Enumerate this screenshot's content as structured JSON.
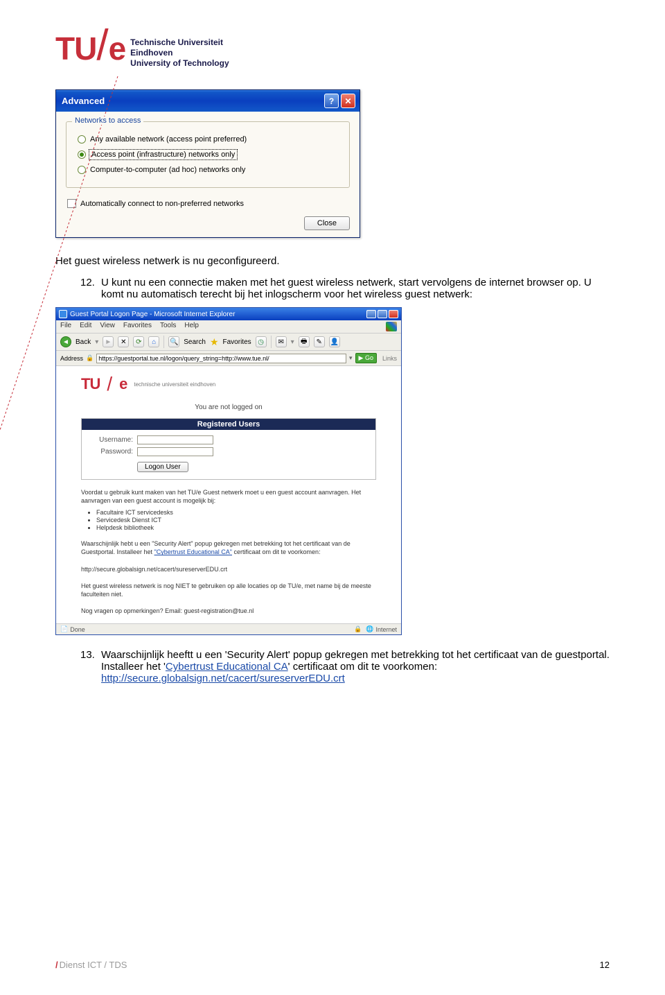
{
  "logo": {
    "tu": "TU",
    "e": "e",
    "line1": "Technische Universiteit",
    "line2_strong": "Eindhoven",
    "line3": "University of Technology"
  },
  "dialog": {
    "title": "Advanced",
    "group_title": "Networks to access",
    "radio1": "Any available network (access point preferred)",
    "radio2": "Access point (infrastructure) networks only",
    "radio3": "Computer-to-computer (ad hoc) networks only",
    "checkbox": "Automatically connect to non-preferred networks",
    "close": "Close"
  },
  "para_intro": "Het guest wireless netwerk is nu geconfigureerd.",
  "step12": {
    "num": "12.",
    "text": "U kunt nu een connectie maken met het guest wireless netwerk, start vervolgens de internet browser op. U komt nu automatisch terecht bij het inlogscherm voor het wireless guest netwerk:"
  },
  "browser": {
    "title": "Guest Portal Logon Page - Microsoft Internet Explorer",
    "menu": [
      "File",
      "Edit",
      "View",
      "Favorites",
      "Tools",
      "Help"
    ],
    "back": "Back",
    "search": "Search",
    "favorites": "Favorites",
    "addr_label": "Address",
    "addr_value": "https://guestportal.tue.nl/logon/query_string=http://www.tue.nl/",
    "go": "Go",
    "links": "Links",
    "page": {
      "uni": "technische universiteit eindhoven",
      "not_logged": "You are not logged on",
      "reg_head": "Registered Users",
      "username": "Username:",
      "password": "Password:",
      "logon": "Logon User",
      "p1": "Voordat u gebruik kunt maken van het TU/e Guest netwerk moet u een guest account aanvragen. Het aanvragen van een guest account is mogelijk bij:",
      "li1": "Facultaire ICT servicedesks",
      "li2": "Servicedesk Dienst ICT",
      "li3": "Helpdesk bibliotheek",
      "p2a": "Waarschijnlijk hebt u een \"Security Alert\" popup gekregen met betrekking tot het certificaat van de Guestportal. Installeer het ",
      "p2_link": "\"Cybertrust Educational CA\"",
      "p2b": " certificaat om dit te voorkomen:",
      "p3": "http://secure.globalsign.net/cacert/sureserverEDU.crt",
      "p4": "Het guest wireless netwerk is nog NIET te gebruiken op alle locaties op de TU/e, met name bij de meeste faculteiten niet.",
      "p5": "Nog vragen op opmerkingen? Email: guest-registration@tue.nl"
    },
    "status_done": "Done",
    "status_zone": "Internet"
  },
  "step13": {
    "num": "13.",
    "text_a": "Waarschijnlijk heeftt u een 'Security Alert' popup gekregen met betrekking tot het certificaat van de guestportal. Installeer het '",
    "link1": "Cybertrust Educational CA",
    "text_b": "' certificaat om dit te voorkomen:",
    "link2": "http://secure.globalsign.net/cacert/sureserverEDU.crt"
  },
  "footer": {
    "slash": "/",
    "dept": "Dienst ICT / TDS",
    "page": "12"
  }
}
